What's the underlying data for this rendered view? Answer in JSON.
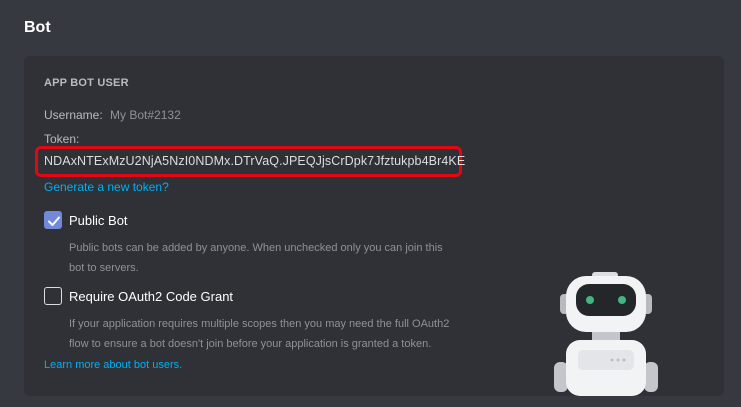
{
  "page": {
    "title": "Bot"
  },
  "bot_user": {
    "section_label": "APP BOT USER",
    "username_label": "Username:",
    "username_value": "My Bot#2132",
    "token_label": "Token:",
    "token_value": "NDAxNTExMzU2NjA5NzI0NDMx.DTrVaQ.JPEQJjsCrDpk7Jfztukpb4Br4KE",
    "regenerate_link": "Generate a new token?"
  },
  "options": {
    "public_bot": {
      "label": "Public Bot",
      "checked": true,
      "description_line1": "Public bots can be added by anyone. When unchecked only you can join this",
      "description_line2": "bot to servers."
    },
    "oauth2_grant": {
      "label": "Require OAuth2 Code Grant",
      "checked": false,
      "description_line1": "If your application requires multiple scopes then you may need the full OAuth2",
      "description_line2": "flow to ensure a bot doesn't join before your application is granted a token."
    }
  },
  "learn_more_link": "Learn more about bot users.",
  "colors": {
    "background": "#36393f",
    "card": "#2f3136",
    "accent": "#7289da",
    "link": "#00aff4",
    "highlight": "#e30613"
  }
}
